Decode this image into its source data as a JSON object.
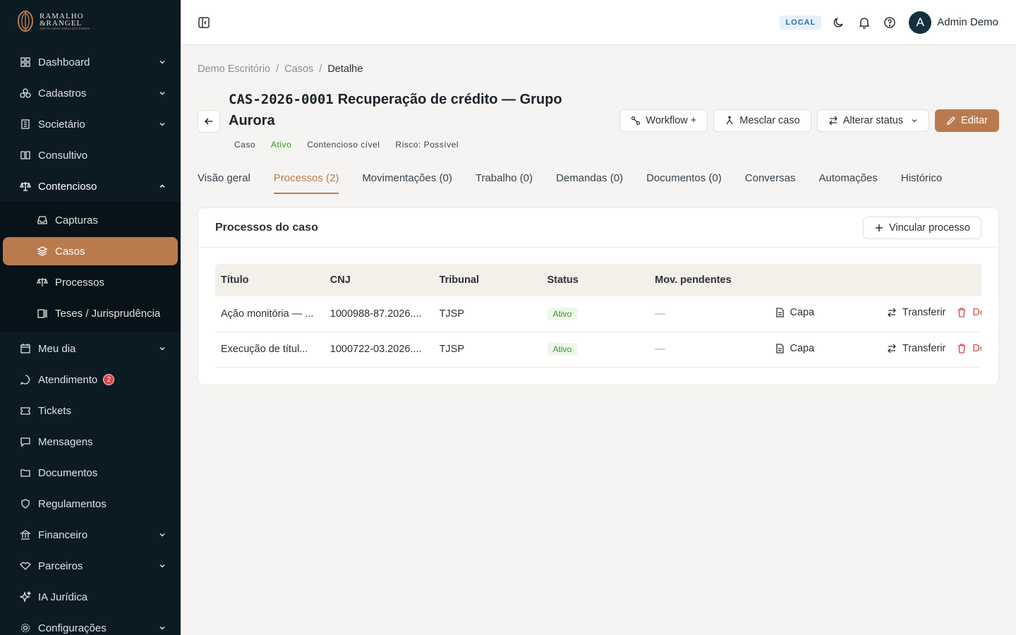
{
  "brand": {
    "line1": "RAMALHO",
    "line2": "&RANGEL",
    "tagline": "ADVOGADOS ESPECIALIZADOS"
  },
  "sidebar": {
    "items": [
      {
        "label": "Dashboard",
        "icon": "grid-icon",
        "chevron": "down"
      },
      {
        "label": "Cadastros",
        "icon": "boxes-icon",
        "chevron": "down"
      },
      {
        "label": "Societário",
        "icon": "building-icon",
        "chevron": "down"
      },
      {
        "label": "Consultivo",
        "icon": "book-icon",
        "chevron": ""
      },
      {
        "label": "Contencioso",
        "icon": "scale-icon",
        "chevron": "up"
      }
    ],
    "sub_items": [
      {
        "label": "Capturas",
        "icon": "inbox-icon"
      },
      {
        "label": "Casos",
        "icon": "layers-icon"
      },
      {
        "label": "Processos",
        "icon": "scale-icon"
      },
      {
        "label": "Teses / Jurisprudência",
        "icon": "library-icon"
      }
    ],
    "items_after": [
      {
        "label": "Meu dia",
        "icon": "calendar-icon",
        "chevron": "down"
      },
      {
        "label": "Atendimento",
        "icon": "chat-icon",
        "badge": "2"
      },
      {
        "label": "Tickets",
        "icon": "ticket-icon"
      },
      {
        "label": "Mensagens",
        "icon": "message-icon"
      },
      {
        "label": "Documentos",
        "icon": "folder-icon"
      },
      {
        "label": "Regulamentos",
        "icon": "shield-icon"
      },
      {
        "label": "Financeiro",
        "icon": "bank-icon",
        "chevron": "down"
      },
      {
        "label": "Parceiros",
        "icon": "handshake-icon",
        "chevron": "down"
      },
      {
        "label": "IA Jurídica",
        "icon": "sparkles-icon"
      },
      {
        "label": "Configurações",
        "icon": "gear-icon",
        "chevron": "down"
      }
    ]
  },
  "topbar": {
    "env": "LOCAL",
    "user": "Admin Demo",
    "avatar_letter": "A"
  },
  "breadcrumb": {
    "first": "Demo Escritório",
    "second": "Casos",
    "current": "Detalhe",
    "sep": "/"
  },
  "case": {
    "code": "CAS-2026-0001",
    "title": "Recuperação de crédito — Grupo Aurora",
    "tags": [
      "Caso",
      "Ativo",
      "Contencioso cível",
      "Risco: Possível"
    ]
  },
  "actions": {
    "workflow": "Workflow +",
    "merge": "Mesclar caso",
    "status": "Alterar status",
    "edit": "Editar"
  },
  "tabs": [
    "Visão geral",
    "Processos (2)",
    "Movimentações (0)",
    "Trabalho (0)",
    "Demandas (0)",
    "Documentos (0)",
    "Conversas",
    "Automações",
    "Histórico"
  ],
  "panel": {
    "title": "Processos do caso",
    "link_button": "Vincular processo",
    "columns": [
      "Título",
      "CNJ",
      "Tribunal",
      "Status",
      "Mov. pendentes"
    ],
    "rows": [
      {
        "titulo": "Ação monitória — ...",
        "cnj": "1000988-87.2026....",
        "tribunal": "TJSP",
        "status": "Ativo",
        "mov": "—",
        "capa": "Capa",
        "transferir": "Transferir",
        "delete": "De"
      },
      {
        "titulo": "Execução de títul...",
        "cnj": "1000722-03.2026....",
        "tribunal": "TJSP",
        "status": "Ativo",
        "mov": "—",
        "capa": "Capa",
        "transferir": "Transferir",
        "delete": "De"
      }
    ]
  },
  "colors": {
    "accent": "#b97b4d",
    "sidebar": "#0c1a24",
    "success": "#3c8d2f"
  }
}
